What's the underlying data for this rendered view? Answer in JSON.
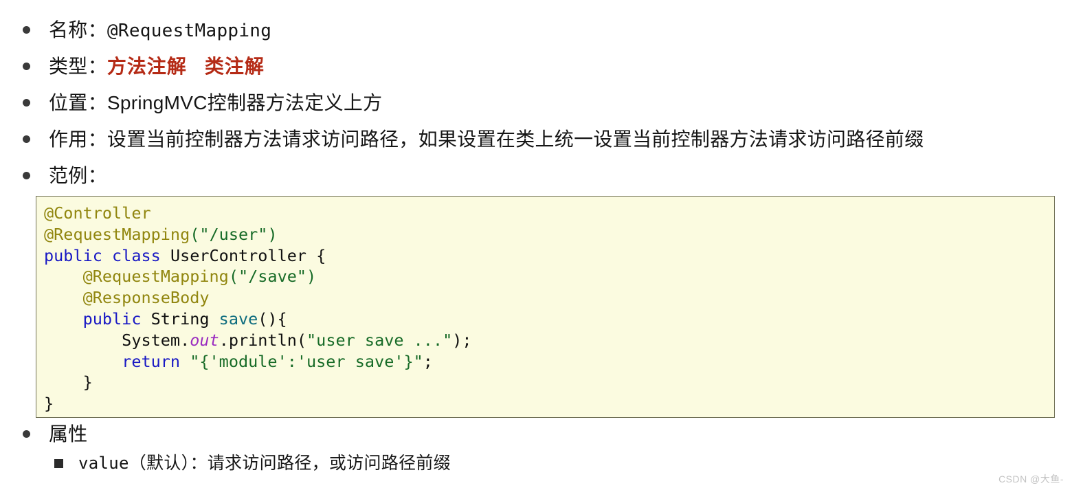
{
  "outline": {
    "items": [
      {
        "label": "名称：",
        "value": "@RequestMapping",
        "value_style": "mono"
      },
      {
        "label": "类型：",
        "value": "",
        "badges": [
          "方法注解",
          "类注解"
        ]
      },
      {
        "label": "位置：",
        "value": "SpringMVC控制器方法定义上方"
      },
      {
        "label": "作用：",
        "value": "设置当前控制器方法请求访问路径，如果设置在类上统一设置当前控制器方法请求访问路径前缀"
      },
      {
        "label": "范例：",
        "value": ""
      },
      {
        "label": "属性",
        "value": ""
      }
    ],
    "sub_items": [
      {
        "name": "value",
        "note": "（默认）：请求访问路径，或访问路径前缀"
      }
    ]
  },
  "code": {
    "lines": [
      [
        {
          "t": "@Controller",
          "c": "anno"
        }
      ],
      [
        {
          "t": "@RequestMapping",
          "c": "anno"
        },
        {
          "t": "(",
          "c": "punc"
        },
        {
          "t": "\"/user\"",
          "c": "str"
        },
        {
          "t": ")",
          "c": "punc"
        }
      ],
      [
        {
          "t": "public",
          "c": "kw"
        },
        {
          "t": " ",
          "c": "plain"
        },
        {
          "t": "class",
          "c": "kw"
        },
        {
          "t": " UserController {",
          "c": "plain"
        }
      ],
      [
        {
          "t": "    ",
          "c": "plain"
        },
        {
          "t": "@RequestMapping",
          "c": "anno"
        },
        {
          "t": "(",
          "c": "punc"
        },
        {
          "t": "\"/save\"",
          "c": "str"
        },
        {
          "t": ")",
          "c": "punc"
        }
      ],
      [
        {
          "t": "    ",
          "c": "plain"
        },
        {
          "t": "@ResponseBody",
          "c": "anno"
        }
      ],
      [
        {
          "t": "    ",
          "c": "plain"
        },
        {
          "t": "public",
          "c": "kw"
        },
        {
          "t": " String ",
          "c": "plain"
        },
        {
          "t": "save",
          "c": "method"
        },
        {
          "t": "(){",
          "c": "plain"
        }
      ],
      [
        {
          "t": "        System.",
          "c": "plain"
        },
        {
          "t": "out",
          "c": "field"
        },
        {
          "t": ".println(",
          "c": "plain"
        },
        {
          "t": "\"user save ...\"",
          "c": "str"
        },
        {
          "t": ");",
          "c": "plain"
        }
      ],
      [
        {
          "t": "        ",
          "c": "plain"
        },
        {
          "t": "return",
          "c": "kw"
        },
        {
          "t": " ",
          "c": "plain"
        },
        {
          "t": "\"{'module':'user save'}\"",
          "c": "str"
        },
        {
          "t": ";",
          "c": "plain"
        }
      ],
      [
        {
          "t": "    }",
          "c": "plain"
        }
      ],
      [
        {
          "t": "}",
          "c": "plain"
        }
      ]
    ]
  },
  "watermark": {
    "text": "CSDN @大鱼-"
  },
  "colors": {
    "annotation": "#91860f",
    "keyword": "#1919c4",
    "string": "#176b27",
    "method": "#0d6c7e",
    "field": "#9a2bc0",
    "badge_red": "#b52b16",
    "code_bg": "#fbfbe0",
    "code_border": "#6f6f55",
    "page_bg": "#ffffff"
  }
}
